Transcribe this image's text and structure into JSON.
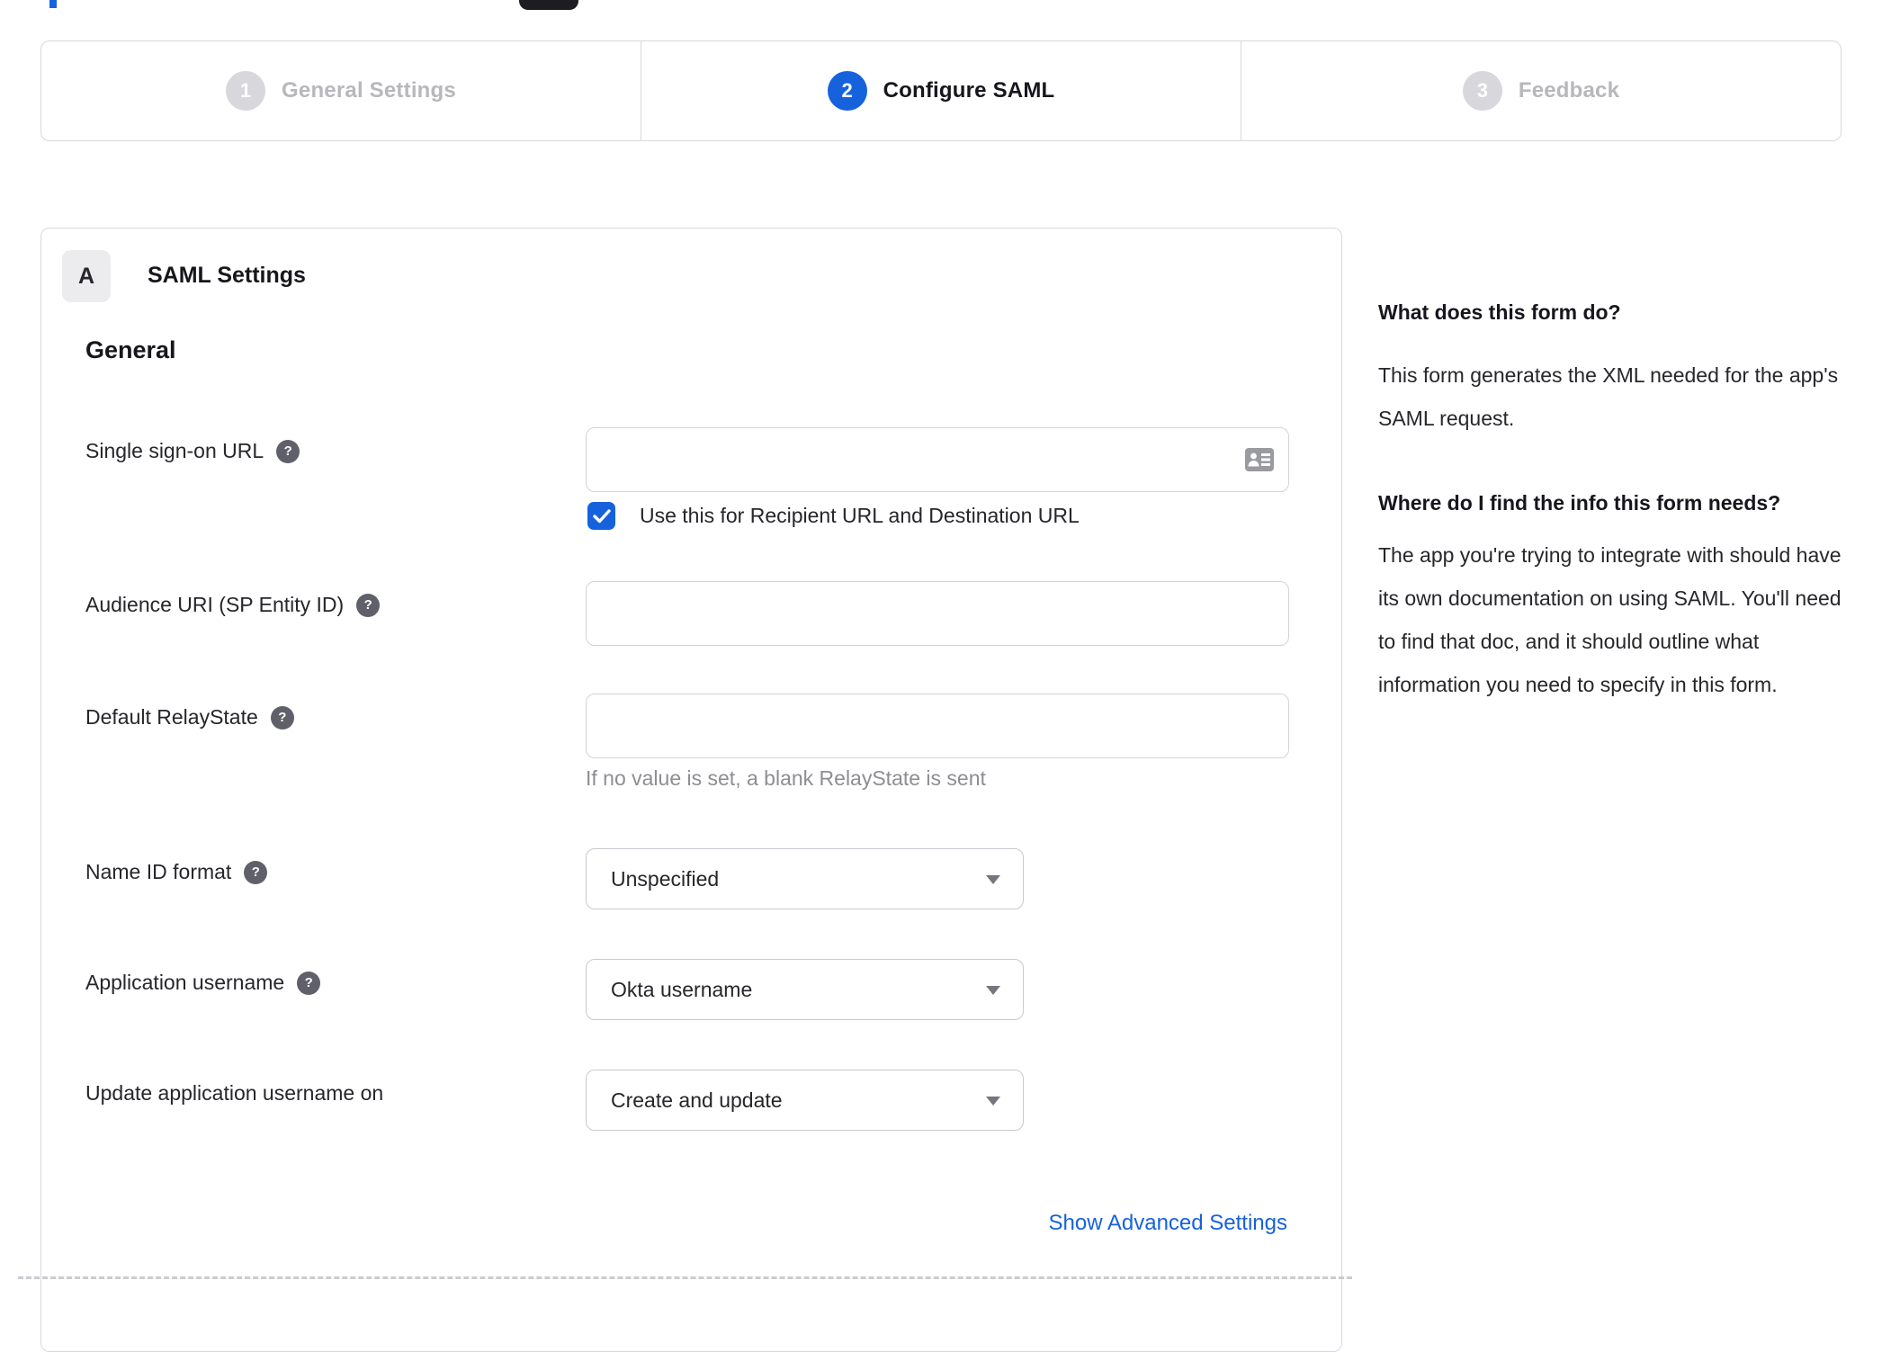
{
  "stepper": {
    "steps": [
      {
        "number": "1",
        "label": "General Settings",
        "active": false
      },
      {
        "number": "2",
        "label": "Configure SAML",
        "active": true
      },
      {
        "number": "3",
        "label": "Feedback",
        "active": false
      }
    ]
  },
  "panel": {
    "badge": "A",
    "title": "SAML Settings",
    "section_heading": "General",
    "advanced_link": "Show Advanced Settings",
    "checkbox_label": "Use this for Recipient URL and Destination URL",
    "checkbox_checked": true
  },
  "fields": {
    "sso": {
      "label": "Single sign-on URL",
      "value": ""
    },
    "audience": {
      "label": "Audience URI (SP Entity ID)",
      "value": ""
    },
    "relay": {
      "label": "Default RelayState",
      "value": "",
      "helper": "If no value is set, a blank RelayState is sent"
    },
    "nameid": {
      "label": "Name ID format",
      "value": "Unspecified"
    },
    "appuser": {
      "label": "Application username",
      "value": "Okta username"
    },
    "update": {
      "label": "Update application username on",
      "value": "Create and update"
    }
  },
  "icons": {
    "help_glyph": "?"
  },
  "sidebar": {
    "sections": [
      {
        "heading": "What does this form do?",
        "body": "This form generates the XML needed for the app's SAML request."
      },
      {
        "heading": "Where do I find the info this form needs?",
        "body": "The app you're trying to integrate with should have its own documentation on using SAML. You'll need to find that doc, and it should outline what information you need to specify in this form."
      }
    ]
  },
  "colors": {
    "accent_blue": "#1662dd",
    "inactive_gray": "#d7d7dc",
    "text_dark": "#16161d",
    "muted_text": "#8d8d93",
    "border_gray": "#d8d8dc"
  }
}
